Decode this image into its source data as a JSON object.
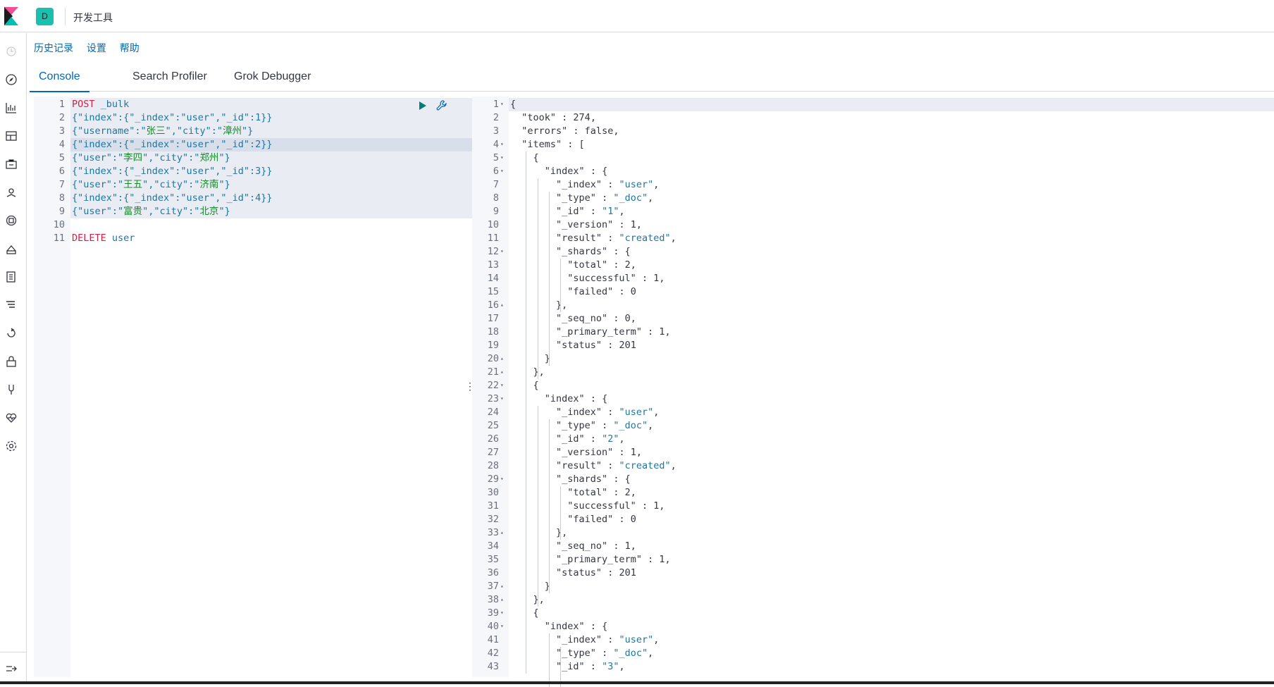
{
  "header": {
    "space_letter": "D",
    "app_title": "开发工具"
  },
  "menu": {
    "history": "历史记录",
    "settings": "设置",
    "help": "帮助"
  },
  "tabs": [
    {
      "label": "Console",
      "active": true
    },
    {
      "label": "Search Profiler",
      "active": false
    },
    {
      "label": "Grok Debugger",
      "active": false
    }
  ],
  "nav_icons": [
    "clock-icon",
    "compass-icon",
    "visualize-icon",
    "dashboard-icon",
    "canvas-icon",
    "maps-icon",
    "ml-icon",
    "infrastructure-icon",
    "logs-icon",
    "apm-icon",
    "uptime-icon",
    "dev-tools-icon",
    "monitoring-icon",
    "management-icon",
    "collapse-icon"
  ],
  "request": {
    "line_numbers": [
      "1",
      "2",
      "3",
      "4",
      "5",
      "6",
      "7",
      "8",
      "9",
      "10",
      "11"
    ],
    "lines": [
      [
        {
          "t": "POST",
          "c": "kw"
        },
        {
          "t": " _bulk",
          "c": "str"
        }
      ],
      [
        {
          "t": "{\"index\":{\"_index\":\"user\",\"_id\":1}}",
          "c": "str"
        }
      ],
      [
        {
          "t": "{\"username\":\"",
          "c": "str"
        },
        {
          "t": "张三",
          "c": "cjk"
        },
        {
          "t": "\",\"city\":\"",
          "c": "str"
        },
        {
          "t": "漳州",
          "c": "cjk"
        },
        {
          "t": "\"}",
          "c": "str"
        }
      ],
      [
        {
          "t": "{\"index\":{\"_index\":\"user\",\"_id\":2}}",
          "c": "str"
        }
      ],
      [
        {
          "t": "{\"user\":\"",
          "c": "str"
        },
        {
          "t": "李四",
          "c": "cjk"
        },
        {
          "t": "\",\"city\":\"",
          "c": "str"
        },
        {
          "t": "郑州",
          "c": "cjk"
        },
        {
          "t": "\"}",
          "c": "str"
        }
      ],
      [
        {
          "t": "{\"index\":{\"_index\":\"user\",\"_id\":3}}",
          "c": "str"
        }
      ],
      [
        {
          "t": "{\"user\":\"",
          "c": "str"
        },
        {
          "t": "王五",
          "c": "cjk"
        },
        {
          "t": "\",\"city\":\"",
          "c": "str"
        },
        {
          "t": "济南",
          "c": "cjk"
        },
        {
          "t": "\"}",
          "c": "str"
        }
      ],
      [
        {
          "t": "{\"index\":{\"_index\":\"user\",\"_id\":4}}",
          "c": "str"
        }
      ],
      [
        {
          "t": "{\"user\":\"",
          "c": "str"
        },
        {
          "t": "富贵",
          "c": "cjk"
        },
        {
          "t": "\",\"city\":\"",
          "c": "str"
        },
        {
          "t": "北京",
          "c": "cjk"
        },
        {
          "t": "\"}",
          "c": "str"
        }
      ],
      [],
      [
        {
          "t": "DELETE",
          "c": "kw"
        },
        {
          "t": " user",
          "c": "str"
        }
      ]
    ]
  },
  "response": {
    "line_numbers": [
      "1",
      "2",
      "3",
      "4",
      "5",
      "6",
      "7",
      "8",
      "9",
      "10",
      "11",
      "12",
      "13",
      "14",
      "15",
      "16",
      "17",
      "18",
      "19",
      "20",
      "21",
      "22",
      "23",
      "24",
      "25",
      "26",
      "27",
      "28",
      "29",
      "30",
      "31",
      "32",
      "33",
      "34",
      "35",
      "36",
      "37",
      "38",
      "39",
      "40",
      "41",
      "42",
      "43"
    ],
    "fold_markers": {
      "1": "▾",
      "4": "▾",
      "5": "▾",
      "6": "▾",
      "12": "▾",
      "16": "▴",
      "20": "▴",
      "21": "▴",
      "22": "▾",
      "23": "▾",
      "29": "▾",
      "33": "▴",
      "37": "▴",
      "38": "▴",
      "39": "▾",
      "40": "▾"
    },
    "lines": [
      "{",
      "  \"took\" : 274,",
      "  \"errors\" : false,",
      "  \"items\" : [",
      "    {",
      "      \"index\" : {",
      "        \"_index\" : \"user\",",
      "        \"_type\" : \"_doc\",",
      "        \"_id\" : \"1\",",
      "        \"_version\" : 1,",
      "        \"result\" : \"created\",",
      "        \"_shards\" : {",
      "          \"total\" : 2,",
      "          \"successful\" : 1,",
      "          \"failed\" : 0",
      "        },",
      "        \"_seq_no\" : 0,",
      "        \"_primary_term\" : 1,",
      "        \"status\" : 201",
      "      }",
      "    },",
      "    {",
      "      \"index\" : {",
      "        \"_index\" : \"user\",",
      "        \"_type\" : \"_doc\",",
      "        \"_id\" : \"2\",",
      "        \"_version\" : 1,",
      "        \"result\" : \"created\",",
      "        \"_shards\" : {",
      "          \"total\" : 2,",
      "          \"successful\" : 1,",
      "          \"failed\" : 0",
      "        },",
      "        \"_seq_no\" : 1,",
      "        \"_primary_term\" : 1,",
      "        \"status\" : 201",
      "      }",
      "    },",
      "    {",
      "      \"index\" : {",
      "        \"_index\" : \"user\",",
      "        \"_type\" : \"_doc\",",
      "        \"_id\" : \"3\","
    ]
  }
}
